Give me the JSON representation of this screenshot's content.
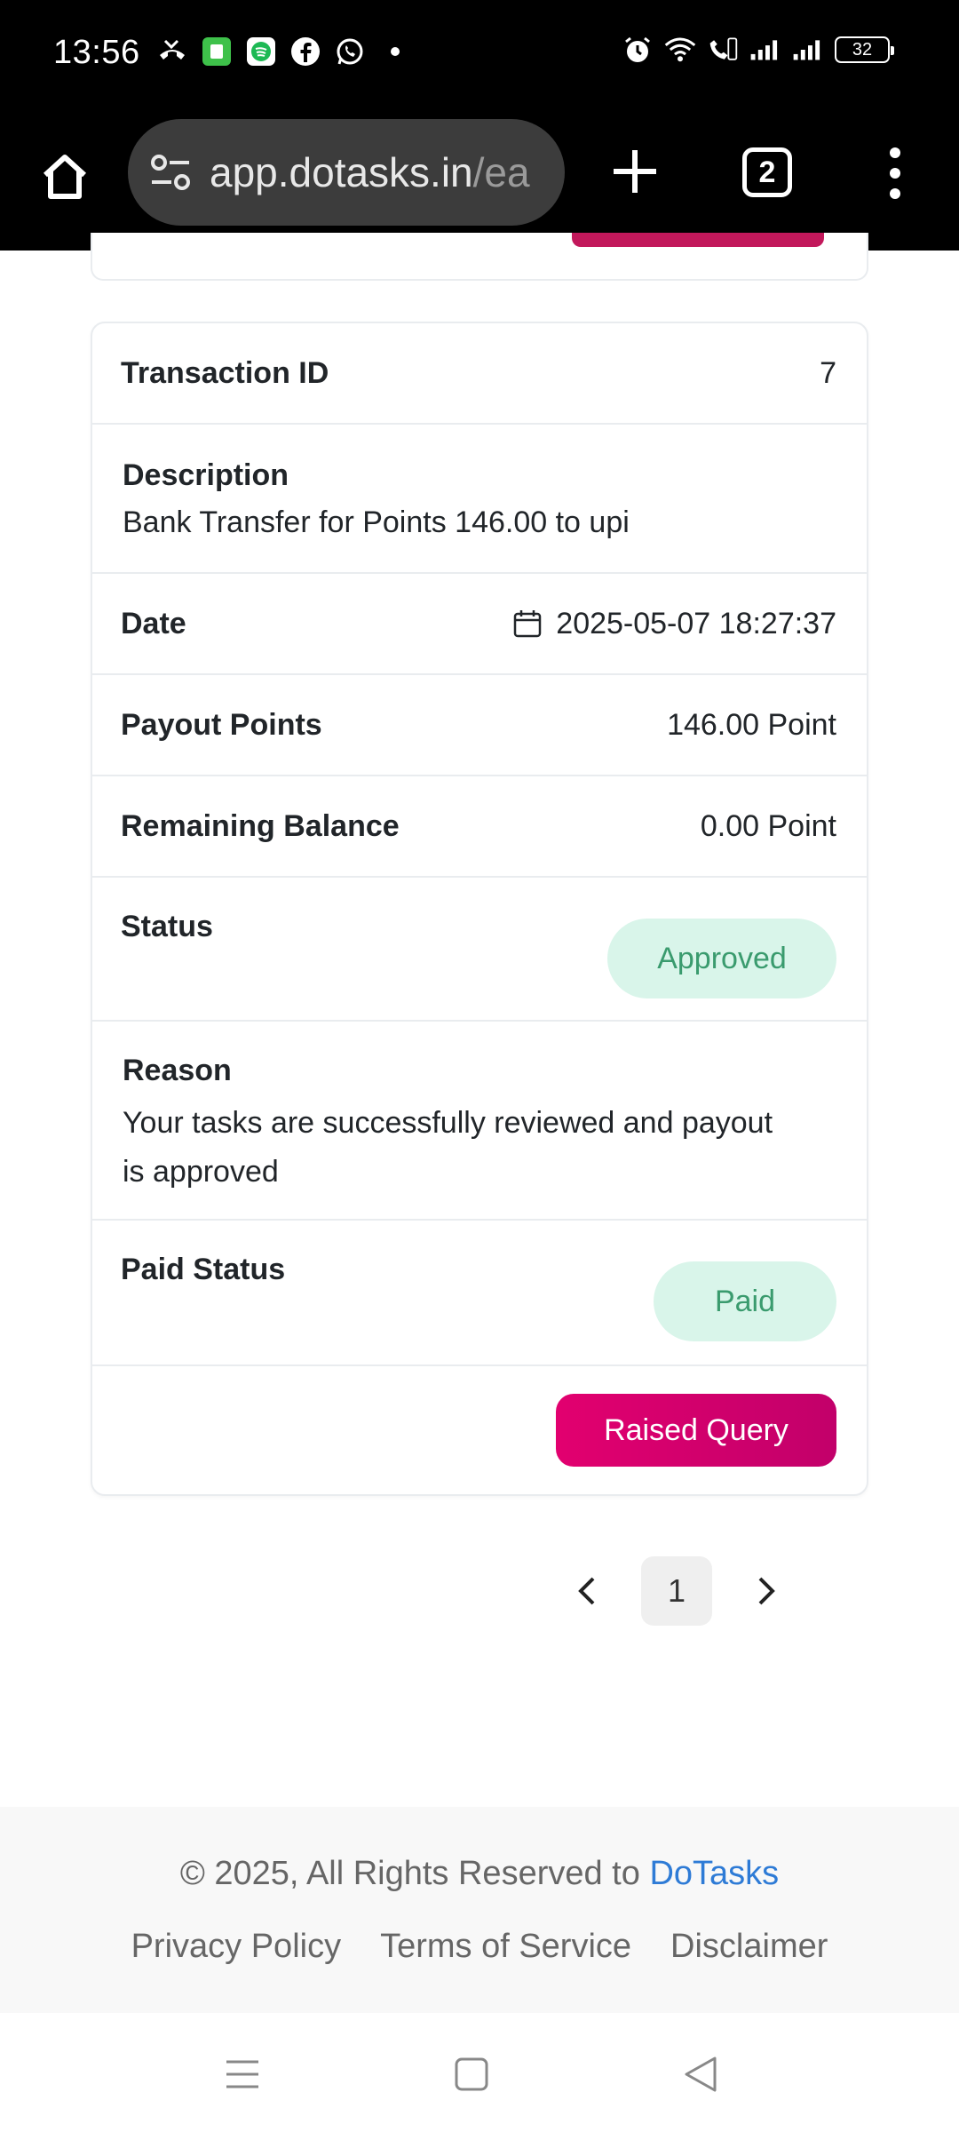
{
  "status_bar": {
    "time": "13:56",
    "battery": "32",
    "left_icons": [
      "missed-call-icon",
      "app-icon",
      "spotify-icon",
      "facebook-icon",
      "whatsapp-icon"
    ],
    "right_icons": [
      "alarm-icon",
      "wifi-icon",
      "volte-icon",
      "signal-icon",
      "signal-icon"
    ]
  },
  "browser": {
    "url_main": "app.dotasks.in",
    "url_rest": "/ea",
    "tab_count": "2"
  },
  "transaction": {
    "id_label": "Transaction ID",
    "id_value": "7",
    "description_label": "Description",
    "description_value": "Bank Transfer for Points 146.00 to upi",
    "date_label": "Date",
    "date_value": "2025-05-07 18:27:37",
    "payout_label": "Payout Points",
    "payout_value": "146.00 Point",
    "remaining_label": "Remaining Balance",
    "remaining_value": "0.00 Point",
    "status_label": "Status",
    "status_value": "Approved",
    "reason_label": "Reason",
    "reason_value": "Your tasks are successfully reviewed and payout is approved",
    "paid_label": "Paid Status",
    "paid_value": "Paid",
    "action_label": "Raised Query"
  },
  "pagination": {
    "current_page": "1"
  },
  "footer": {
    "copyright_prefix": "© 2025, All Rights Reserved to ",
    "brand": "DoTasks",
    "links": [
      "Privacy Policy",
      "Terms of Service",
      "Disclaimer"
    ]
  },
  "colors": {
    "accent": "#e2006f",
    "badge_bg": "#d9f5ea",
    "badge_text": "#3a9b6e",
    "brand_link": "#2e7bd6"
  }
}
